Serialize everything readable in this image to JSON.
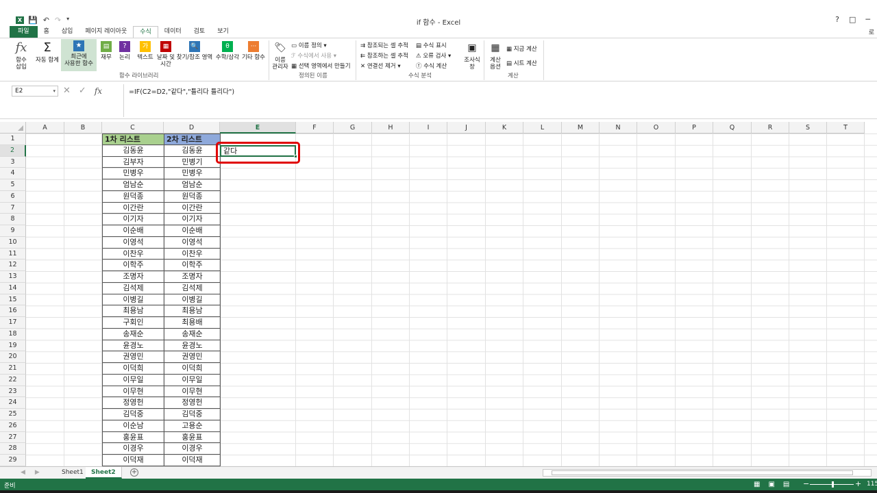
{
  "window": {
    "title": "if 함수 - Excel",
    "help": "?",
    "restore": "□",
    "minimize": "─",
    "user": "로"
  },
  "ribbon_tabs": [
    "파일",
    "홈",
    "삽입",
    "페이지 레이아웃",
    "수식",
    "데이터",
    "검토",
    "보기"
  ],
  "active_tab": "수식",
  "ribbon": {
    "insert_function": "함수\n삽입",
    "autosum": "자동 합계",
    "recent": "최근에\n사용한 함수",
    "financial": "재무",
    "logical": "논리",
    "text": "텍스트",
    "datetime": "날짜 및\n시간",
    "lookup": "찾기/참조 영역",
    "math": "수학/삼각",
    "more": "기타 함수",
    "library_label": "함수 라이브러리",
    "name_manager": "이름\n관리자",
    "define_name": "이름 정의",
    "use_in_formula": "수식에서 사용",
    "create_from_selection": "선택 영역에서 만들기",
    "defined_names_label": "정의된 이름",
    "trace_precedents": "참조되는 셀 추적",
    "trace_dependents": "참조하는 셀 추적",
    "remove_arrows": "연결선 제거",
    "show_formulas": "수식 표시",
    "error_checking": "오류 검사",
    "evaluate_formula": "수식 계산",
    "watch_window": "조사식\n창",
    "auditing_label": "수식 분석",
    "calc_options": "계산\n옵션",
    "calc_now": "지금 계산",
    "calc_sheet": "시트 계산",
    "calc_label": "계산"
  },
  "name_box": "E2",
  "formula": "=IF(C2=D2,\"같다\",\"틀리다 틀리다\")",
  "columns": [
    "A",
    "B",
    "C",
    "D",
    "E",
    "F",
    "G",
    "H",
    "I",
    "J",
    "K",
    "L",
    "M",
    "N",
    "O",
    "P",
    "Q",
    "R",
    "S",
    "T"
  ],
  "rows": [
    "1",
    "2",
    "3",
    "4",
    "5",
    "6",
    "7",
    "8",
    "9",
    "10",
    "11",
    "12",
    "13",
    "14",
    "15",
    "16",
    "17",
    "18",
    "19",
    "20",
    "21",
    "22",
    "23",
    "24",
    "25",
    "26",
    "27",
    "28",
    "29"
  ],
  "headers": {
    "c1": "1차 리스트",
    "d1": "2차 리스트"
  },
  "list1": [
    "김동윤",
    "김부자",
    "민병우",
    "엄남순",
    "원덕종",
    "이간란",
    "이기자",
    "이순배",
    "이영석",
    "이찬우",
    "이학주",
    "조명자",
    "김석제",
    "이병길",
    "최용남",
    "구회인",
    "송재순",
    "윤경노",
    "권영민",
    "이덕희",
    "이무일",
    "이무현",
    "정영헌",
    "김덕중",
    "이순남",
    "홍윤표",
    "이경우",
    "이덕재"
  ],
  "list2": [
    "김동윤",
    "민병기",
    "민병우",
    "엄남순",
    "원덕종",
    "이간란",
    "이기자",
    "이순배",
    "이영석",
    "이찬우",
    "이학주",
    "조명자",
    "김석제",
    "이병길",
    "최용남",
    "최용배",
    "송재순",
    "윤경노",
    "권영민",
    "이덕희",
    "이무일",
    "이무현",
    "정영헌",
    "김덕중",
    "고용순",
    "홍윤표",
    "이경우",
    "이덕재"
  ],
  "e2": "같다",
  "sheets": [
    "Sheet1",
    "Sheet2"
  ],
  "active_sheet": "Sheet2",
  "status": {
    "ready": "준비",
    "zoom": "115"
  },
  "colors": {
    "accent": "#217346",
    "header1": "#a9d08e",
    "header2": "#8ea9db",
    "highlight": "#e00000"
  }
}
